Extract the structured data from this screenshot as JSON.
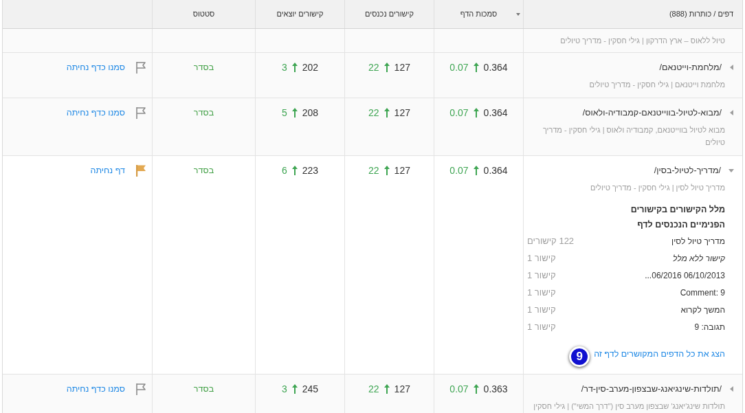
{
  "table": {
    "columns": [
      {
        "label": "דפים / כותרות (888)",
        "sorted": false
      },
      {
        "label": "סמכות הדף",
        "sorted": true
      },
      {
        "label": "קישורים נכנסים",
        "sorted": false
      },
      {
        "label": "קישורים יוצאים",
        "sorted": false
      },
      {
        "label": "סטטוס",
        "sorted": false
      }
    ],
    "rows": [
      {
        "subtitle": "טיול ללאוס – ארץ הדרקון | גילי חסקין - מדריך טיולים"
      },
      {
        "title": "/מלחמת-וייטנאם/",
        "subtitle": "מלחמת וייטנאם | גילי חסקין - מדריך טיולים",
        "expanded": false,
        "authority": {
          "value": "0.364",
          "change": "0.07",
          "rising": true
        },
        "incoming": {
          "value": "127",
          "change": "22",
          "rising": true
        },
        "outgoing": {
          "value": "202",
          "change": "3",
          "rising": true
        },
        "status": "בסדר",
        "landing": false,
        "landing_label": "סמנו כדף נחיתה"
      },
      {
        "title": "/מבוא-לטיול-בווייטנאם-קמבודיה-ולאוס/",
        "subtitle": "מבוא לטיול בווייטנאם, קמבודיה ולאוס | גילי חסקין - מדריך טיולים",
        "expanded": false,
        "authority": {
          "value": "0.364",
          "change": "0.07",
          "rising": true
        },
        "incoming": {
          "value": "127",
          "change": "22",
          "rising": true
        },
        "outgoing": {
          "value": "208",
          "change": "5",
          "rising": true
        },
        "status": "בסדר",
        "landing": false,
        "landing_label": "סמנו כדף נחיתה"
      },
      {
        "title": "/מדריך-לטיול-בסין/",
        "subtitle": "מדריך טיול לסין | גילי חסקין - מדריך טיולים",
        "expanded": true,
        "authority": {
          "value": "0.364",
          "change": "0.07",
          "rising": true
        },
        "incoming": {
          "value": "127",
          "change": "22",
          "rising": true
        },
        "outgoing": {
          "value": "223",
          "change": "6",
          "rising": true
        },
        "status": "בסדר",
        "landing": true,
        "landing_label": "דף נחיתה",
        "anchors": {
          "heading": "מלל הקישורים בקישורים הפנימיים הנכנסים לדף",
          "items": [
            {
              "text": "מדריך טיול לסין",
              "count": "122 קישורים",
              "kind": "text"
            },
            {
              "text": "קישור ללא מלל",
              "count": "קישור 1",
              "kind": "empty"
            },
            {
              "text": "06/10/2013 06/2016...",
              "count": "קישור 1",
              "kind": "text"
            },
            {
              "text": "Comment: 9",
              "count": "קישור 1",
              "kind": "text"
            },
            {
              "text": "המשך לקרוא",
              "count": "קישור 1",
              "kind": "text"
            },
            {
              "text": "תגובה: 9",
              "count": "קישור 1",
              "kind": "text"
            }
          ],
          "link": "הצג את כל הדפים המקושרים לדף זה",
          "callout": "9"
        }
      },
      {
        "title": "/תולדות-שינגיאנג-שבצפון-מערב-סין-דר/",
        "subtitle": "תולדות שינג'יאנג' שבצפון מערב סין (\"דרך המשי\") | גילי חסקין",
        "expanded": false,
        "authority": {
          "value": "0.363",
          "change": "0.07",
          "rising": true
        },
        "incoming": {
          "value": "127",
          "change": "22",
          "rising": true
        },
        "outgoing": {
          "value": "245",
          "change": "3",
          "rising": true
        },
        "status": "בסדר",
        "landing": false,
        "landing_label": "סמנו כדף נחיתה"
      }
    ]
  }
}
